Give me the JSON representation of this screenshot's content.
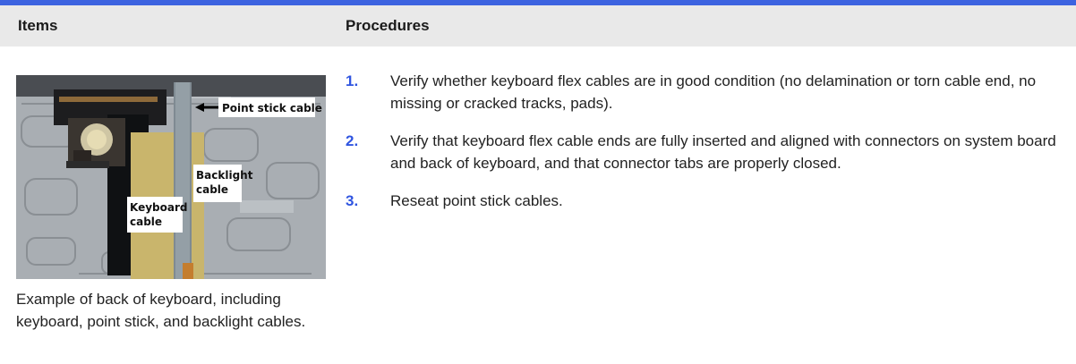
{
  "colors": {
    "accent": "#3c63e0",
    "number": "#3055e0",
    "header_bg": "#e9e9e9"
  },
  "table": {
    "headers": {
      "items": "Items",
      "procedures": "Procedures"
    },
    "image": {
      "labels": {
        "point_stick": "Point stick cable",
        "backlight_line1": "Backlight",
        "backlight_line2": "cable",
        "keyboard_line1": "Keyboard",
        "keyboard_line2": "cable"
      },
      "caption": "Example of back of keyboard, including keyboard, point stick, and backlight cables."
    },
    "steps": [
      {
        "number": "1.",
        "text": "Verify whether keyboard flex cables are in good condition (no delamination or torn cable end, no missing or cracked tracks, pads)."
      },
      {
        "number": "2.",
        "text": "Verify that keyboard flex cable ends are fully inserted and aligned with connectors on system board and back of keyboard, and that connector tabs are properly closed."
      },
      {
        "number": "3.",
        "text": "Reseat point stick cables."
      }
    ]
  }
}
